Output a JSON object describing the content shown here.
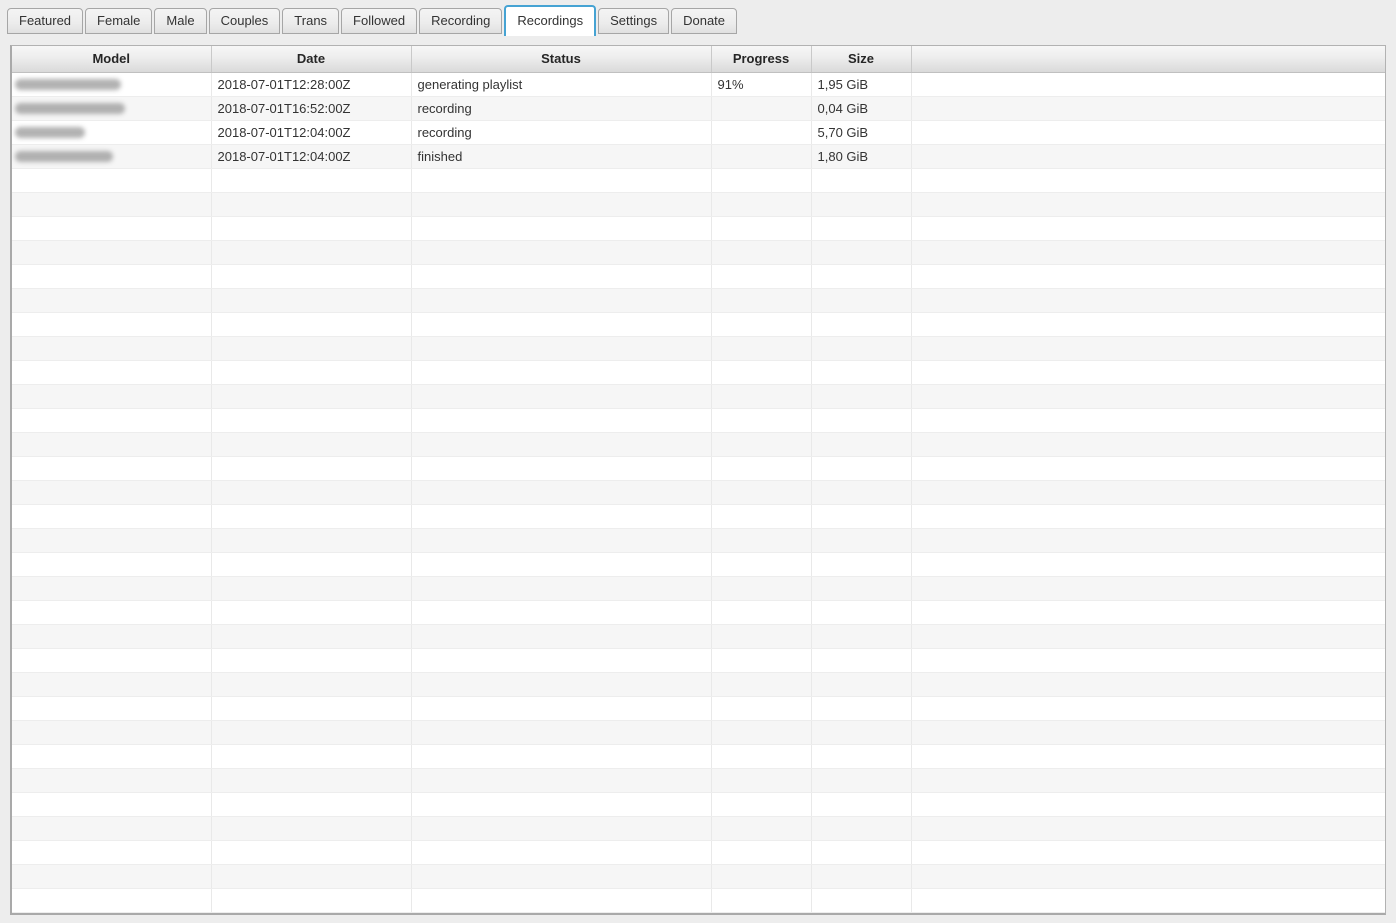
{
  "tabs": {
    "items": [
      {
        "label": "Featured",
        "active": false
      },
      {
        "label": "Female",
        "active": false
      },
      {
        "label": "Male",
        "active": false
      },
      {
        "label": "Couples",
        "active": false
      },
      {
        "label": "Trans",
        "active": false
      },
      {
        "label": "Followed",
        "active": false
      },
      {
        "label": "Recording",
        "active": false
      },
      {
        "label": "Recordings",
        "active": true
      },
      {
        "label": "Settings",
        "active": false
      },
      {
        "label": "Donate",
        "active": false
      }
    ]
  },
  "table": {
    "columns": [
      {
        "key": "model",
        "label": "Model"
      },
      {
        "key": "date",
        "label": "Date"
      },
      {
        "key": "status",
        "label": "Status"
      },
      {
        "key": "progress",
        "label": "Progress"
      },
      {
        "key": "size",
        "label": "Size"
      },
      {
        "key": "filler",
        "label": ""
      }
    ],
    "rows": [
      {
        "model_redacted": true,
        "model_blur_width": 106,
        "date": "2018-07-01T12:28:00Z",
        "status": "generating playlist",
        "progress": "91%",
        "size": "1,95 GiB"
      },
      {
        "model_redacted": true,
        "model_blur_width": 110,
        "date": "2018-07-01T16:52:00Z",
        "status": "recording",
        "progress": "",
        "size": "0,04 GiB"
      },
      {
        "model_redacted": true,
        "model_blur_width": 70,
        "date": "2018-07-01T12:04:00Z",
        "status": "recording",
        "progress": "",
        "size": "5,70 GiB"
      },
      {
        "model_redacted": true,
        "model_blur_width": 98,
        "date": "2018-07-01T12:04:00Z",
        "status": "finished",
        "progress": "",
        "size": "1,80 GiB"
      }
    ],
    "empty_row_count": 31
  },
  "colors": {
    "active_tab_border": "#46a3d3",
    "page_background": "#ededed",
    "row_stripe": "#f6f6f6"
  }
}
